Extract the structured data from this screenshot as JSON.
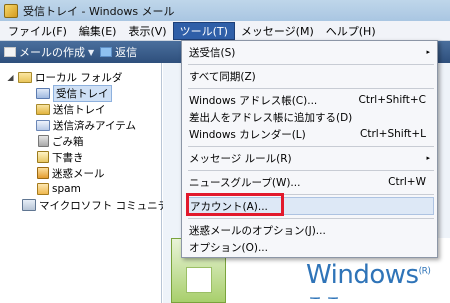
{
  "window": {
    "title": "受信トレイ - Windows メール"
  },
  "menubar": [
    "ファイル(F)",
    "編集(E)",
    "表示(V)",
    "ツール(T)",
    "メッセージ(M)",
    "ヘルプ(H)"
  ],
  "toolbar": {
    "compose": "メールの作成",
    "reply": "返信"
  },
  "tree": {
    "root": "ローカル フォルダ",
    "folders": [
      "受信トレイ",
      "送信トレイ",
      "送信済みアイテム",
      "ごみ箱",
      "下書き",
      "迷惑メール",
      "spam"
    ],
    "news": "マイクロソフト コミュニティ"
  },
  "tools_menu": {
    "items": [
      {
        "label": "送受信(S)",
        "shortcut": "",
        "submenu": "▸"
      },
      {
        "label": "すべて同期(Z)",
        "shortcut": "",
        "submenu": ""
      },
      {
        "label": "Windows アドレス帳(C)...",
        "shortcut": "Ctrl+Shift+C",
        "submenu": ""
      },
      {
        "label": "差出人をアドレス帳に追加する(D)",
        "shortcut": "",
        "submenu": ""
      },
      {
        "label": "Windows カレンダー(L)",
        "shortcut": "Ctrl+Shift+L",
        "submenu": ""
      },
      {
        "label": "メッセージ ルール(R)",
        "shortcut": "",
        "submenu": "▸"
      },
      {
        "label": "ニュースグループ(W)...",
        "shortcut": "Ctrl+W",
        "submenu": ""
      },
      {
        "label": "アカウント(A)...",
        "shortcut": "",
        "submenu": ""
      },
      {
        "label": "迷惑メールのオプション(J)...",
        "shortcut": "",
        "submenu": ""
      },
      {
        "label": "オプション(O)...",
        "shortcut": "",
        "submenu": ""
      }
    ]
  },
  "preview": {
    "brand": "Windows",
    "reg": "(R)",
    "sub": "ここ"
  },
  "colors": {
    "accent": "#2f5fa8",
    "highlight_frame": "#e2192c",
    "brand_blue": "#2f74b8"
  }
}
